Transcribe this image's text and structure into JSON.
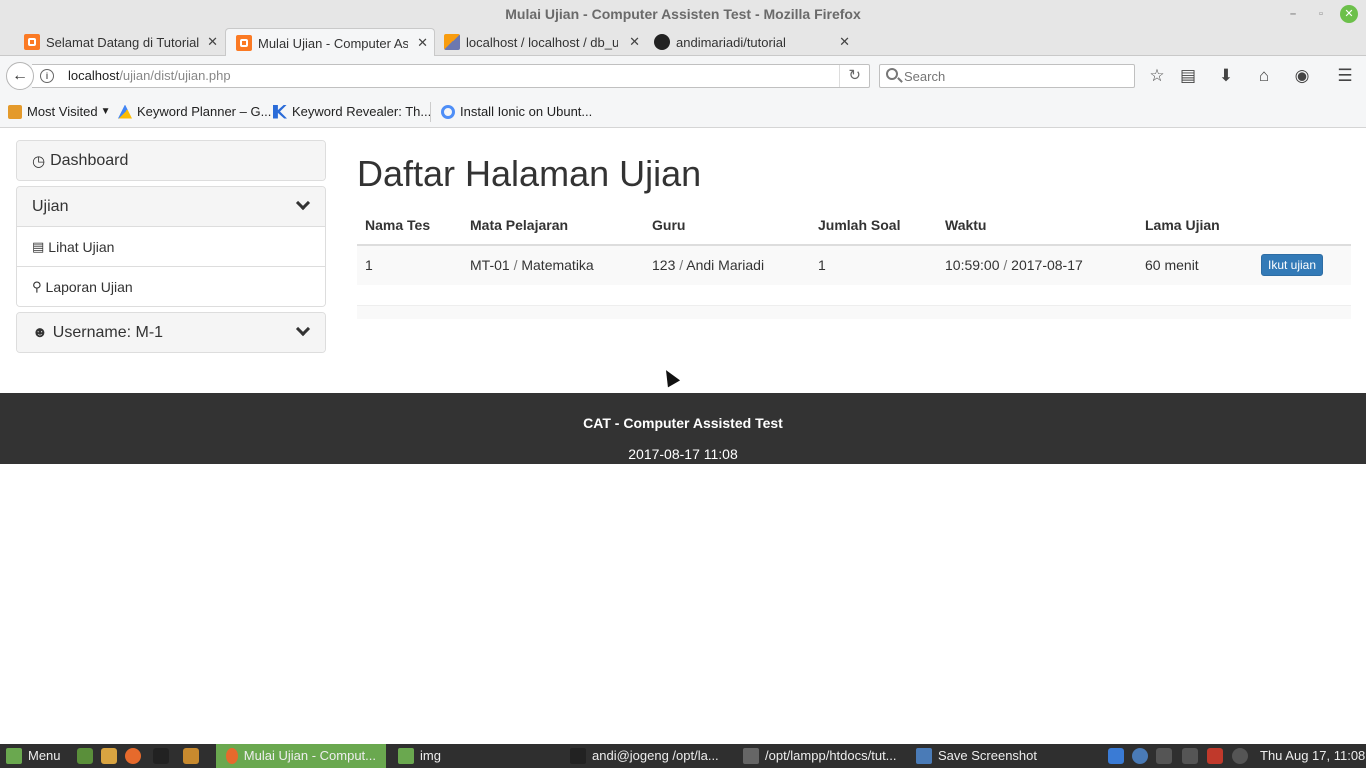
{
  "window": {
    "title": "Mulai Ujian - Computer Assisten Test - Mozilla Firefox"
  },
  "tabs": [
    {
      "label": "Selamat Datang di Tutorial",
      "favicon": "xampp-icon"
    },
    {
      "label": "Mulai Ujian - Computer Ass",
      "favicon": "xampp-icon",
      "active": true
    },
    {
      "label": "localhost / localhost / db_uji",
      "favicon": "phpmyadmin-icon"
    },
    {
      "label": "andimariadi/tutorial",
      "favicon": "github-icon"
    }
  ],
  "urlbar": {
    "host": "localhost",
    "path": "/ujian/dist/ujian.php"
  },
  "search": {
    "placeholder": "Search"
  },
  "bookmarks": [
    {
      "label": "Most Visited",
      "icon": "folder-icon"
    },
    {
      "label": "Keyword Planner – G...",
      "icon": "google-ads-icon"
    },
    {
      "label": "Keyword Revealer: Th...",
      "icon": "k-icon"
    },
    {
      "label": "Install Ionic on Ubunt...",
      "icon": "ionic-icon"
    }
  ],
  "sidebar": {
    "dashboard": "Dashboard",
    "ujian": "Ujian",
    "items": [
      {
        "label": "Lihat Ujian",
        "icon": "list-icon"
      },
      {
        "label": "Laporan Ujian",
        "icon": "search-icon"
      }
    ],
    "username": "Username: M-1"
  },
  "main": {
    "title": "Daftar Halaman Ujian",
    "columns": [
      "Nama Tes",
      "Mata Pelajaran",
      "Guru",
      "Jumlah Soal",
      "Waktu",
      "Lama Ujian"
    ],
    "rows": [
      {
        "nama_tes": "1",
        "mapel_code": "MT-01",
        "mapel_name": "Matematika",
        "guru_id": "123",
        "guru_name": "Andi Mariadi",
        "jumlah_soal": "1",
        "waktu_time": "10:59:00",
        "waktu_date": "2017-08-17",
        "lama": "60 menit",
        "action": "Ikut ujian"
      }
    ],
    "separator": " / "
  },
  "footer": {
    "title": "CAT - Computer Assisted Test",
    "date": "2017-08-17 11:08"
  },
  "taskbar": {
    "menu": "Menu",
    "windows": [
      {
        "label": "Mulai Ujian - Comput...",
        "active": true
      },
      {
        "label": "img"
      },
      {
        "label": "andi@jogeng /opt/la..."
      },
      {
        "label": "/opt/lampp/htdocs/tut..."
      },
      {
        "label": "Save Screenshot"
      }
    ],
    "clock": "Thu Aug 17, 11:08"
  },
  "colors": {
    "primary_button": "#337ab7",
    "footer_bg": "#333333",
    "taskbar_active": "#6aa84f"
  }
}
